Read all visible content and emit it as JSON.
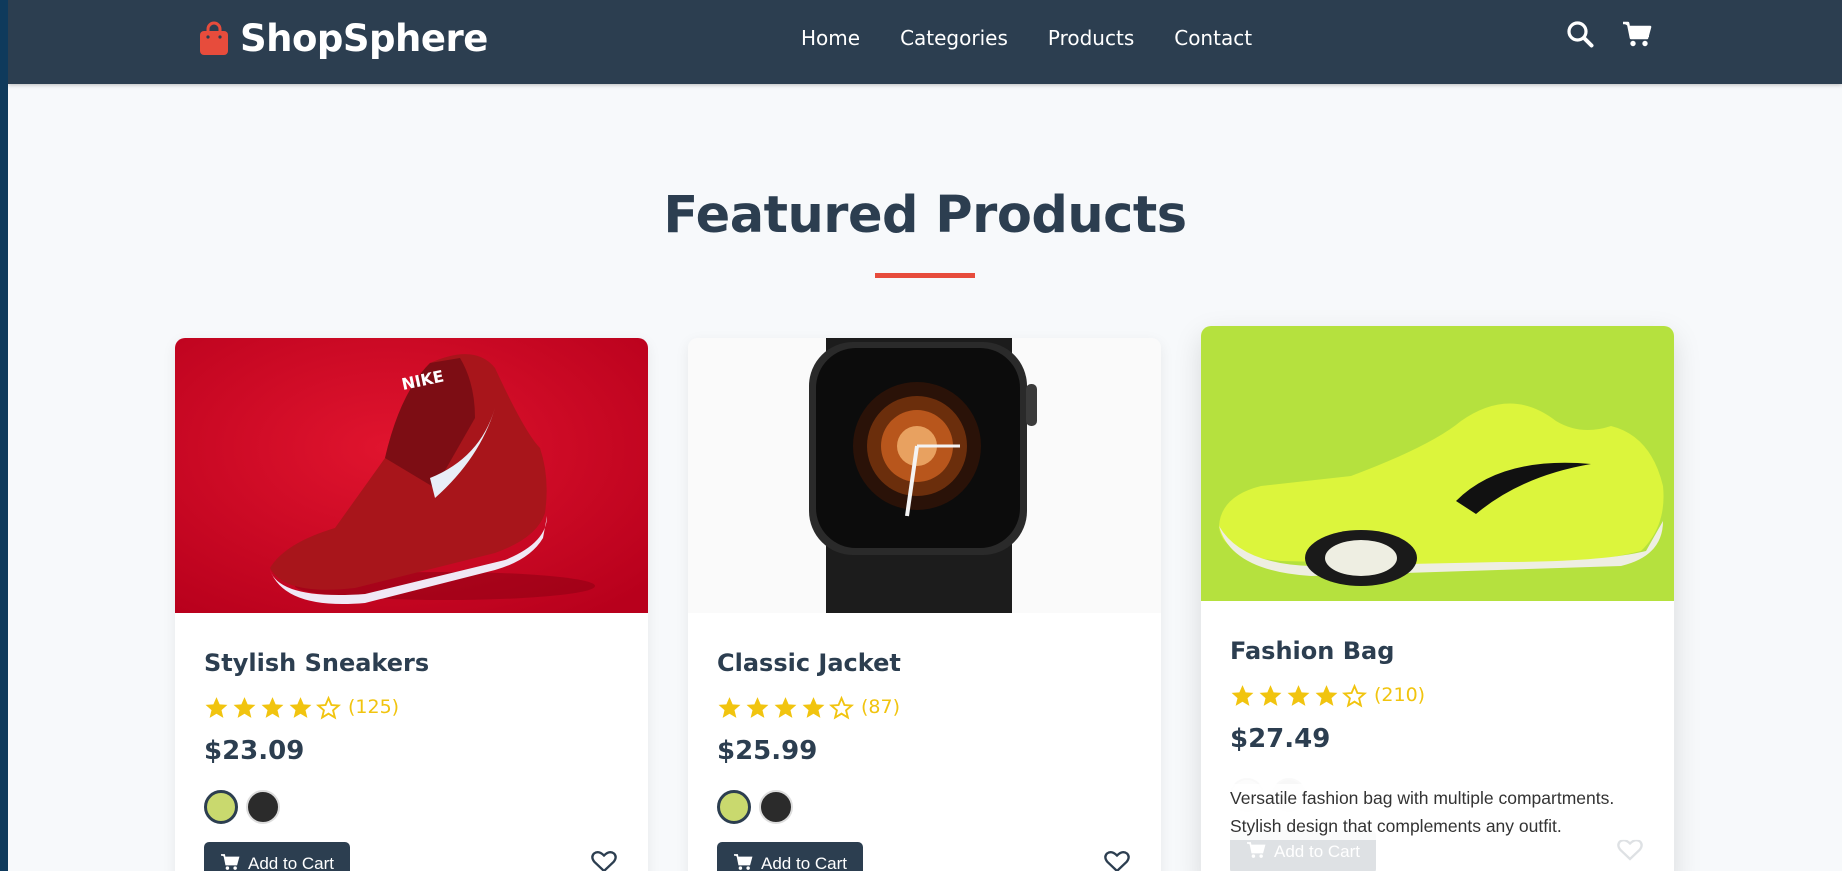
{
  "brand": {
    "name": "ShopSphere",
    "icon": "shopping-bag-icon"
  },
  "nav": {
    "links": [
      "Home",
      "Categories",
      "Products",
      "Contact"
    ],
    "icons": [
      "search-icon",
      "cart-icon"
    ]
  },
  "section": {
    "title": "Featured Products"
  },
  "colors": {
    "nav_bg": "#2c3e50",
    "accent": "#e74c3c",
    "star": "#f1c40f"
  },
  "products": [
    {
      "title": "Stylish Sneakers",
      "rating": 4,
      "rating_count": "(125)",
      "price": "$23.09",
      "swatches": [
        "#c9d96e",
        "#2b2b2b"
      ],
      "add_label": "Add to Cart"
    },
    {
      "title": "Classic Jacket",
      "rating": 4,
      "rating_count": "(87)",
      "price": "$25.99",
      "swatches": [
        "#c9d96e",
        "#2b2b2b"
      ],
      "add_label": "Add to Cart"
    },
    {
      "title": "Fashion Bag",
      "rating": 4,
      "rating_count": "(210)",
      "price": "$27.49",
      "description": "Versatile fashion bag with multiple compartments. Stylish design that complements any outfit.",
      "add_label": "Add to Cart"
    }
  ]
}
